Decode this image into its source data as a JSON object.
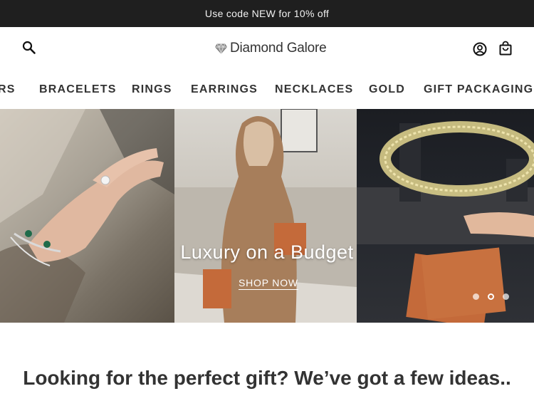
{
  "announcement": {
    "text": "Use code NEW for 10% off"
  },
  "header": {
    "logo_text": "Diamond Galore",
    "icons": {
      "search": "search-icon",
      "account": "account-icon",
      "cart": "shopping-bag-icon",
      "logo": "diamond-icon"
    }
  },
  "nav": {
    "items": [
      {
        "label": "RS"
      },
      {
        "label": "BRACELETS"
      },
      {
        "label": "RINGS"
      },
      {
        "label": "EARRINGS"
      },
      {
        "label": "NECKLACES"
      },
      {
        "label": "GOLD"
      },
      {
        "label": "GIFT PACKAGING"
      }
    ]
  },
  "hero": {
    "title": "Luxury on a Budget",
    "cta_label": "SHOP NOW",
    "slides": {
      "count": 3,
      "active_index": 1
    }
  },
  "section": {
    "title": "Looking for the perfect gift? We’ve got a few ideas.."
  },
  "colors": {
    "announcement_bg": "#1f1f1f",
    "text": "#333333",
    "background": "#ffffff"
  }
}
